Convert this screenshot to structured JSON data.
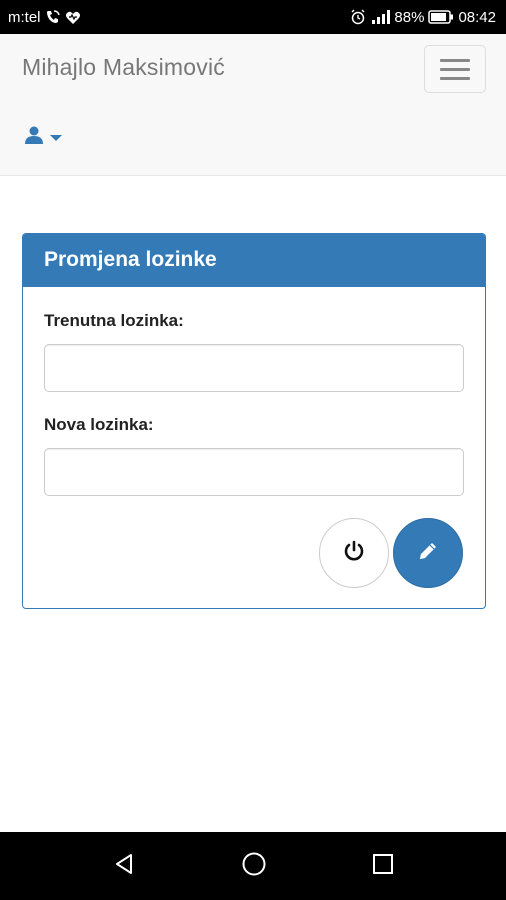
{
  "status_bar": {
    "carrier": "m:tel",
    "battery": "88%",
    "time": "08:42",
    "icons": [
      "wifi-call-icon",
      "heart-icon",
      "alarm-icon",
      "signal-icon",
      "battery-icon"
    ]
  },
  "navbar": {
    "brand": "Mihajlo Maksimović",
    "toggle_icon": "hamburger-menu-icon",
    "user_icon": "user-icon",
    "caret_icon": "caret-down-icon"
  },
  "panel": {
    "title": "Promjena lozinke",
    "current_password_label": "Trenutna lozinka:",
    "current_password_value": "",
    "new_password_label": "Nova lozinka:",
    "new_password_value": "",
    "logout_icon": "power-icon",
    "submit_icon": "pencil-icon"
  },
  "colors": {
    "primary": "#337ab7",
    "navbar_bg": "#f8f8f8",
    "brand_text": "#777777"
  },
  "system_nav": [
    "back-icon",
    "home-icon",
    "recents-icon"
  ]
}
